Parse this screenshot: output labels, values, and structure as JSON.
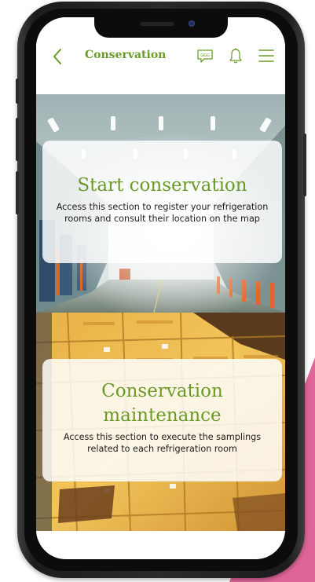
{
  "app": {
    "header_title": "Conservation"
  },
  "header_icons": {
    "back": "chevron-left-icon",
    "chat": "chat-bubble-icon",
    "chat_text": "GGG",
    "notifications": "bell-icon",
    "menu": "hamburger-menu-icon"
  },
  "sections": [
    {
      "title": "Start conservation",
      "description": "Access this section to register your refrigeration rooms and consult their location on the map",
      "background": "cold-storage-warehouse-photo"
    },
    {
      "title": "Conservation maintenance",
      "description": "Access this section to execute the samplings related to each refrigeration room",
      "background": "stacked-yellow-crates-photo"
    }
  ],
  "colors": {
    "accent": "#6a9a28",
    "pink_decoration": "#d94a86",
    "card_background": "rgba(255,255,255,0.84)"
  }
}
